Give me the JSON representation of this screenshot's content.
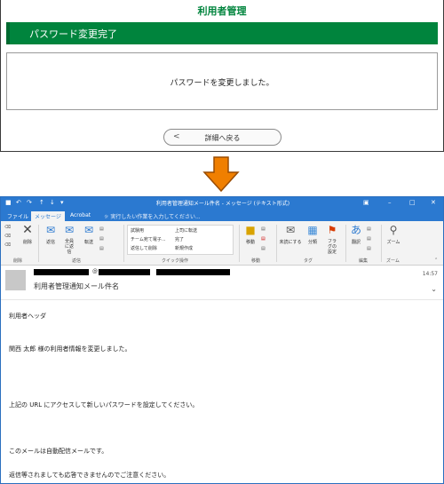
{
  "web_page": {
    "system_title": "利用者管理",
    "header_title": "パスワード変更完了",
    "message": "パスワードを変更しました。",
    "back_button": "詳細へ戻る",
    "back_chevron": "<"
  },
  "outlook": {
    "window_title": "利用者管理通知メール件名 - メッセージ (テキスト形式)",
    "tabs": [
      "ファイル",
      "メッセージ",
      "Acrobat"
    ],
    "active_tab": "メッセージ",
    "tell_me": "実行したい作業を入力してください...",
    "ribbon": {
      "delete_group": {
        "label": "削除",
        "delete": "削除"
      },
      "respond_group": {
        "label": "返信",
        "reply": "返信",
        "reply_all": "全員に返信",
        "forward": "転送"
      },
      "quick_steps": {
        "label": "クイック操作",
        "items": [
          "試験用",
          "チーム宛て電子...",
          "返信して削除",
          "上司に転送",
          "完了",
          "新規作成"
        ]
      },
      "move_group": {
        "label": "移動",
        "move": "移動"
      },
      "tags_group": {
        "label": "タグ",
        "unread": "未読にする",
        "categorize": "分類",
        "flag": "フラグの設定"
      },
      "editing_group": {
        "label": "編集",
        "translate": "翻訳"
      },
      "zoom_group": {
        "label": "ズーム",
        "zoom": "ズーム"
      }
    },
    "message": {
      "sender_at": "@",
      "time": "14:57",
      "subject": "利用者管理通知メール件名",
      "body": [
        "利用者ヘッダ",
        "関西 太郎 様の利用者情報を変更しました。",
        "上記の URL にアクセスして新しいパスワードを設定してください。",
        "このメールは自動配信メールです。",
        "返信等されましても応答できませんのでご注意ください。"
      ]
    }
  },
  "colors": {
    "brand_green": "#00843d",
    "outlook_blue": "#2b79d0",
    "arrow_orange": "#f07f00"
  }
}
